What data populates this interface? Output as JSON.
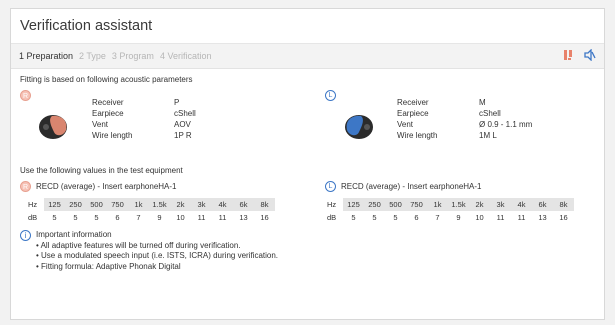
{
  "window": {
    "title": "Verification assistant"
  },
  "steps": [
    {
      "label": "1 Preparation",
      "active": true
    },
    {
      "label": "2 Type",
      "active": false
    },
    {
      "label": "3 Program",
      "active": false
    },
    {
      "label": "4 Verification",
      "active": false
    }
  ],
  "toolbar": {
    "icons": [
      "hearing-aid-tool-icon",
      "speaker-muted-icon"
    ]
  },
  "content": {
    "fitting_intro": "Fitting is based on following acoustic parameters",
    "right_ear": {
      "badge": "R",
      "params": [
        {
          "label": "Receiver",
          "value": "P"
        },
        {
          "label": "Earpiece",
          "value": "cShell"
        },
        {
          "label": "Vent",
          "value": "AOV"
        },
        {
          "label": "Wire length",
          "value": "1P R"
        }
      ]
    },
    "left_ear": {
      "badge": "L",
      "params": [
        {
          "label": "Receiver",
          "value": "M"
        },
        {
          "label": "Earpiece",
          "value": "cShell"
        },
        {
          "label": "Vent",
          "value": "Ø 0.9 - 1.1 mm"
        },
        {
          "label": "Wire length",
          "value": "1M L"
        }
      ]
    },
    "test_equipment_intro": "Use the following values in the test equipment",
    "recd_right": {
      "badge": "R",
      "title": "RECD (average) - Insert earphoneHA-1"
    },
    "recd_left": {
      "badge": "L",
      "title": "RECD (average) - Insert earphoneHA-1"
    },
    "recd_table": {
      "hz_label": "Hz",
      "db_label": "dB",
      "hz": [
        "125",
        "250",
        "500",
        "750",
        "1k",
        "1.5k",
        "2k",
        "3k",
        "4k",
        "6k",
        "8k"
      ],
      "db": [
        "5",
        "5",
        "5",
        "6",
        "7",
        "9",
        "10",
        "11",
        "11",
        "13",
        "16"
      ]
    },
    "info": {
      "heading": "Important information",
      "lines": [
        "• All adaptive features will be turned off during verification.",
        "• Use a modulated speech input (i.e. ISTS, ICRA) during verification.",
        "• Fitting formula: Adaptive Phonak Digital"
      ]
    }
  },
  "colors": {
    "right_ear": "#e8826b",
    "left_ear": "#3d77c6",
    "step_inactive": "#b6b6b6"
  }
}
